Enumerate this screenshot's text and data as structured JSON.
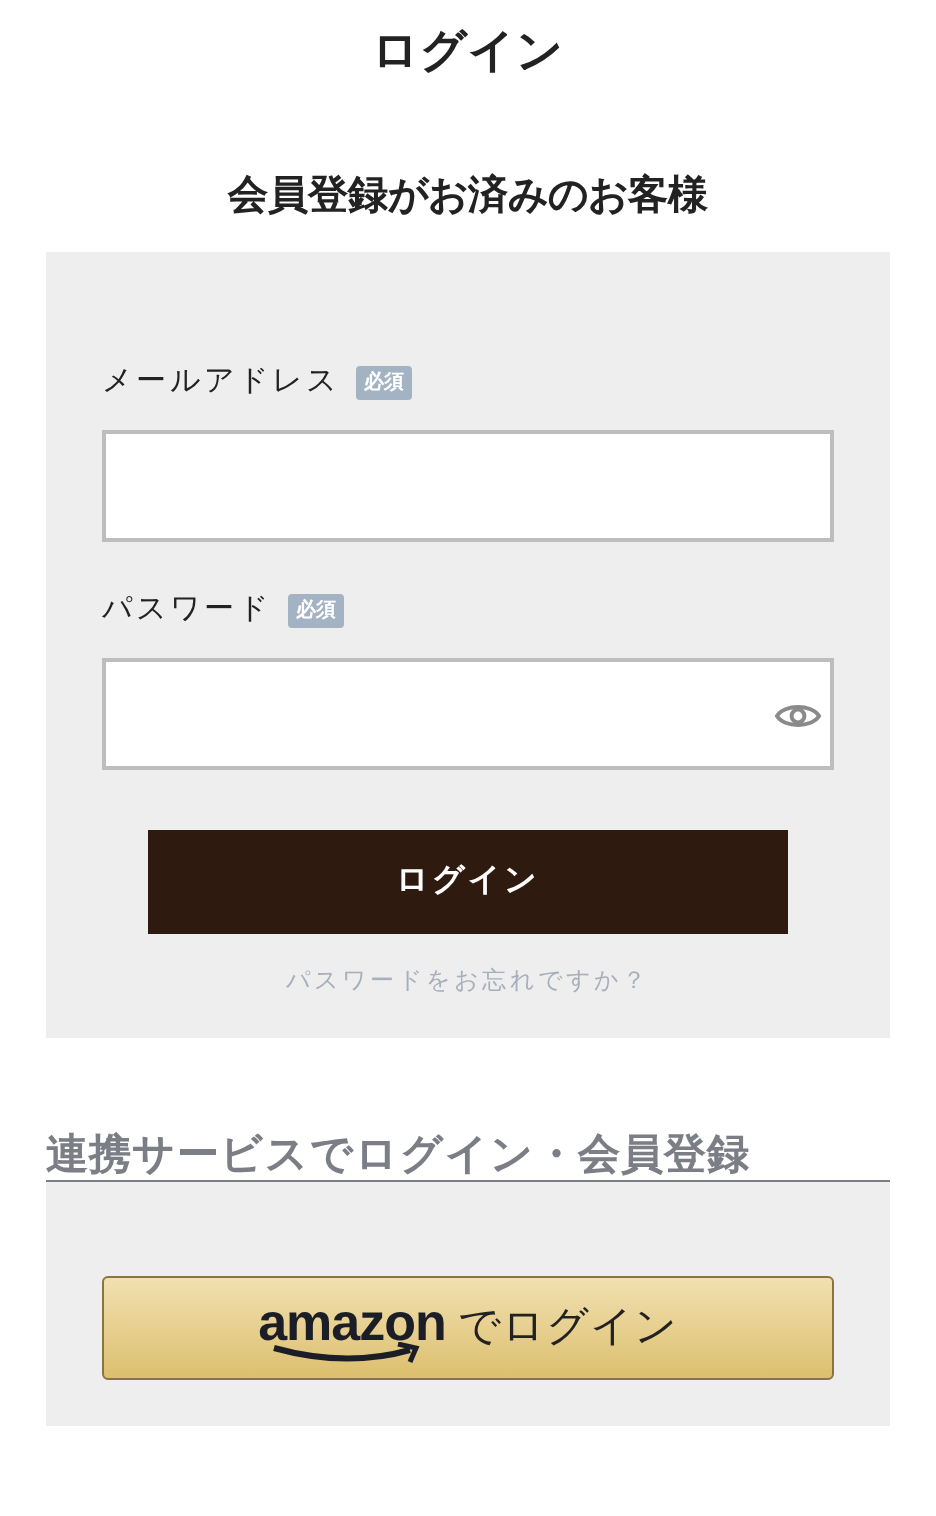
{
  "title": "ログイン",
  "member_section": {
    "heading": "会員登録がお済みのお客様",
    "fields": [
      {
        "kind": "text",
        "label": "メールアドレス",
        "badge": "必須"
      },
      {
        "kind": "password",
        "label": "パスワード",
        "badge": "必須"
      }
    ],
    "submit": "ログイン",
    "forgot_link": "パスワードをお忘れですか？"
  },
  "social_section": {
    "heading": "連携サービスでログイン・会員登録",
    "amazon_button": {
      "logo": "amazon",
      "label": "でログイン"
    }
  }
}
